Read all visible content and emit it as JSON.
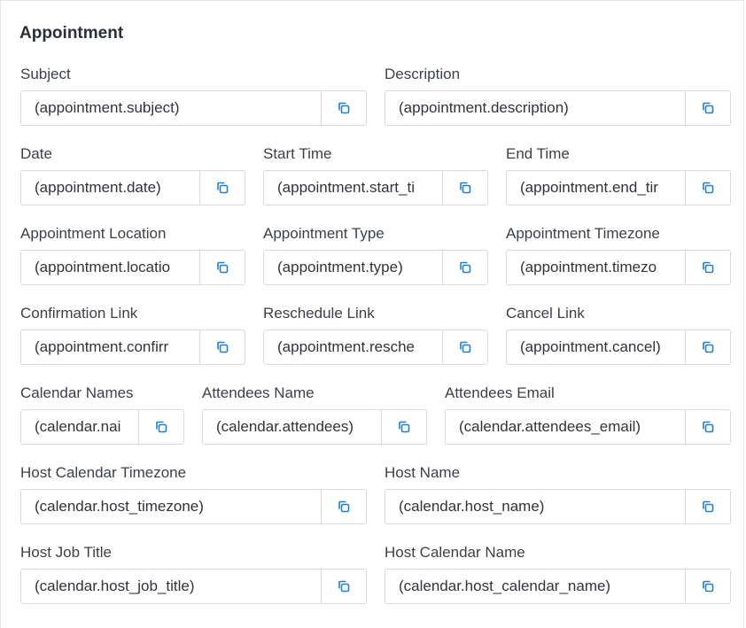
{
  "section_title": "Appointment",
  "icon": "copy-icon",
  "accent_color": "#1f7fd0",
  "fields": [
    {
      "key": "subject",
      "label": "Subject",
      "value": "(appointment.subject)"
    },
    {
      "key": "description",
      "label": "Description",
      "value": "(appointment.description)"
    },
    {
      "key": "date",
      "label": "Date",
      "value": "(appointment.date)"
    },
    {
      "key": "start-time",
      "label": "Start Time",
      "value": "(appointment.start_ti"
    },
    {
      "key": "end-time",
      "label": "End Time",
      "value": "(appointment.end_tir"
    },
    {
      "key": "appointment-location",
      "label": "Appointment Location",
      "value": "(appointment.locatio"
    },
    {
      "key": "appointment-type",
      "label": "Appointment Type",
      "value": "(appointment.type)"
    },
    {
      "key": "appointment-timezone",
      "label": "Appointment Timezone",
      "value": "(appointment.timezo"
    },
    {
      "key": "confirmation-link",
      "label": "Confirmation Link",
      "value": "(appointment.confirr"
    },
    {
      "key": "reschedule-link",
      "label": "Reschedule Link",
      "value": "(appointment.resche"
    },
    {
      "key": "cancel-link",
      "label": "Cancel Link",
      "value": "(appointment.cancel)"
    },
    {
      "key": "calendar-names",
      "label": "Calendar Names",
      "value": "(calendar.nai"
    },
    {
      "key": "attendees-name",
      "label": "Attendees Name",
      "value": "(calendar.attendees)"
    },
    {
      "key": "attendees-email",
      "label": "Attendees Email",
      "value": "(calendar.attendees_email)"
    },
    {
      "key": "host-calendar-timezone",
      "label": "Host Calendar Timezone",
      "value": "(calendar.host_timezone)"
    },
    {
      "key": "host-name",
      "label": "Host Name",
      "value": "(calendar.host_name)"
    },
    {
      "key": "host-job-title",
      "label": "Host Job Title",
      "value": "(calendar.host_job_title)"
    },
    {
      "key": "host-calendar-name",
      "label": "Host Calendar Name",
      "value": "(calendar.host_calendar_name)"
    }
  ]
}
